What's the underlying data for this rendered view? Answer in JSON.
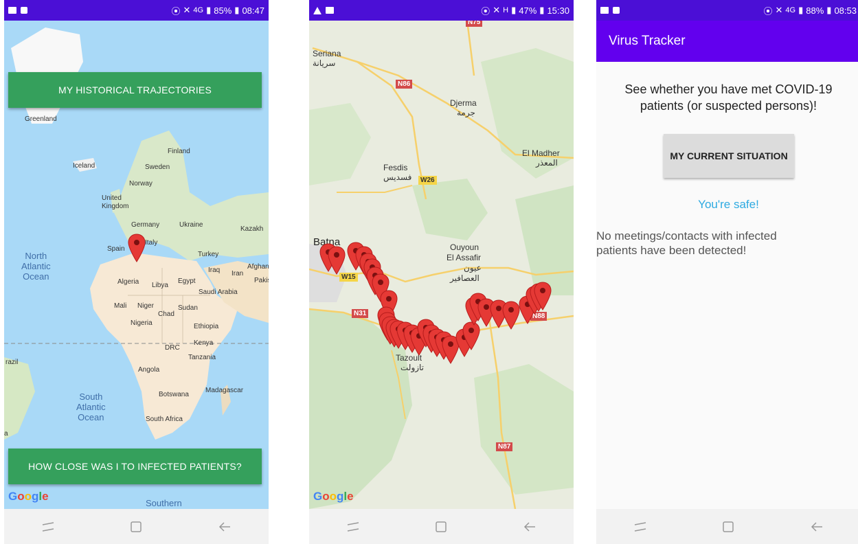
{
  "screen1": {
    "status": {
      "network": "4G",
      "battery": "85%",
      "time": "08:47"
    },
    "historical_button": "MY HISTORICAL TRAJECTORIES",
    "close_button": "HOW CLOSE WAS I TO INFECTED PATIENTS?",
    "map_labels": [
      "Greenland",
      "Iceland",
      "Finland",
      "Sweden",
      "Norway",
      "United",
      "Kingdom",
      "Germany",
      "Ukraine",
      "Kazakh",
      "Spain",
      "Italy",
      "Turkey",
      "Iraq",
      "Iran",
      "Afghan",
      "Pakis",
      "Algeria",
      "Libya",
      "Egypt",
      "Saudi Arabia",
      "Mali",
      "Niger",
      "Chad",
      "Sudan",
      "Nigeria",
      "Ethiopia",
      "Kenya",
      "DRC",
      "Tanzania",
      "Angola",
      "Botswana",
      "Madagascar",
      "South Africa",
      "razil",
      "a",
      "Southern"
    ],
    "oceans": [
      "North",
      "Atlantic",
      "Ocean",
      "South",
      "Atlantic",
      "Ocean"
    ],
    "google": "Google"
  },
  "screen2": {
    "status": {
      "network": "H",
      "battery": "47%",
      "time": "15:30"
    },
    "places": [
      "Seriana",
      "سريانة",
      "Djerma",
      "جرمة",
      "El Madher",
      "المعذر",
      "Fesdis",
      "فسديس",
      "Batna",
      "Ouyoun",
      "El Assafir",
      "عيون",
      "العصافير",
      "Tazoult",
      "تازولت"
    ],
    "roads": [
      "N75",
      "N86",
      "W26",
      "W15",
      "N31",
      "N88",
      "N87"
    ],
    "google": "Google"
  },
  "screen3": {
    "status": {
      "network": "4G",
      "battery": "88%",
      "time": "08:53"
    },
    "app_title": "Virus Tracker",
    "intro_line1": "See whether you have met COVID-19",
    "intro_line2": "patients (or suspected persons)!",
    "situation_button": "MY CURRENT SITUATION",
    "safe_text": "You're safe!",
    "result_line1": "No meetings/contacts with infected",
    "result_line2": "patients have been detected!"
  },
  "colors": {
    "status_bar": "#4b0fd6",
    "app_bar": "#6200ee",
    "green_button": "#35a05c",
    "marker": "#e53935",
    "safe_text": "#2eaae1"
  }
}
